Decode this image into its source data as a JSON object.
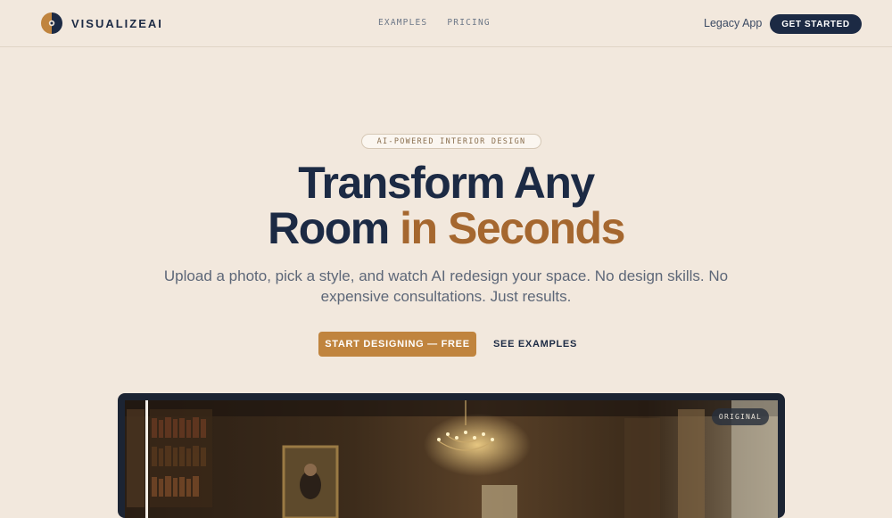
{
  "brand": {
    "name": "VISUALIZEAI",
    "logo_icon": "half-circle-eye-icon",
    "accent": "#c0843e",
    "dark": "#1c2a44"
  },
  "nav": {
    "links": [
      "EXAMPLES",
      "PRICING"
    ],
    "legacy_label": "Legacy App",
    "cta_label": "GET STARTED"
  },
  "hero": {
    "badge": "AI-POWERED INTERIOR DESIGN",
    "headline_line1": "Transform Any",
    "headline_line2_a": "Room",
    "headline_line2_b": "in Seconds",
    "subtitle": "Upload a photo, pick a style, and watch AI redesign your space. No design skills. No expensive consultations. Just results.",
    "primary_cta": "START DESIGNING — FREE",
    "secondary_cta": "SEE EXAMPLES"
  },
  "preview": {
    "label": "ORIGINAL",
    "image": "dark-library-chandelier-room"
  },
  "colors": {
    "background": "#f2e8dd",
    "accent_text": "#a5672f"
  }
}
